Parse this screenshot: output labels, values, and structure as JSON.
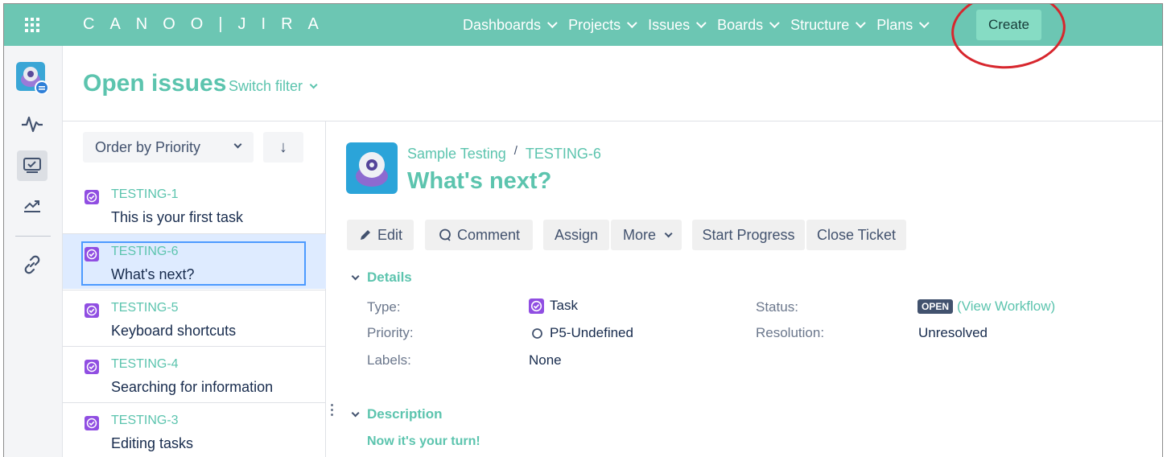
{
  "nav": {
    "logo": "CANOO|JIRA",
    "items": [
      {
        "label": "Dashboards"
      },
      {
        "label": "Projects"
      },
      {
        "label": "Issues"
      },
      {
        "label": "Boards"
      },
      {
        "label": "Structure"
      },
      {
        "label": "Plans"
      }
    ],
    "create_label": "Create",
    "bar_color": "#6cc6b3",
    "accent_color": "#5cc4ae"
  },
  "sidebar": {
    "icons": [
      "project-avatar-icon",
      "activity-icon",
      "issues-icon",
      "reports-icon",
      "link-icon"
    ]
  },
  "header": {
    "title": "Open issues",
    "switch_filter": "Switch filter"
  },
  "list": {
    "order_label": "Order by Priority",
    "sort_direction": "↓",
    "items": [
      {
        "key": "TESTING-1",
        "summary": "This is your first task"
      },
      {
        "key": "TESTING-6",
        "summary": "What's next?",
        "selected": true
      },
      {
        "key": "TESTING-5",
        "summary": "Keyboard shortcuts"
      },
      {
        "key": "TESTING-4",
        "summary": "Searching for information"
      },
      {
        "key": "TESTING-3",
        "summary": "Editing tasks"
      }
    ]
  },
  "issue": {
    "project": "Sample Testing",
    "crumb_sep": "/",
    "key": "TESTING-6",
    "title": "What's next?",
    "actions": {
      "edit": "Edit",
      "comment": "Comment",
      "assign": "Assign",
      "more": "More",
      "start_progress": "Start Progress",
      "close_ticket": "Close Ticket"
    },
    "details_heading": "Details",
    "fields": {
      "type_label": "Type:",
      "type_value": "Task",
      "priority_label": "Priority:",
      "priority_value": "P5-Undefined",
      "labels_label": "Labels:",
      "labels_value": "None",
      "status_label": "Status:",
      "status_badge": "OPEN",
      "view_workflow_open": "(",
      "view_workflow": "View Workflow",
      "view_workflow_close": ")",
      "resolution_label": "Resolution:",
      "resolution_value": "Unresolved"
    },
    "description_heading": "Description",
    "description_text": "Now it's your turn!"
  }
}
